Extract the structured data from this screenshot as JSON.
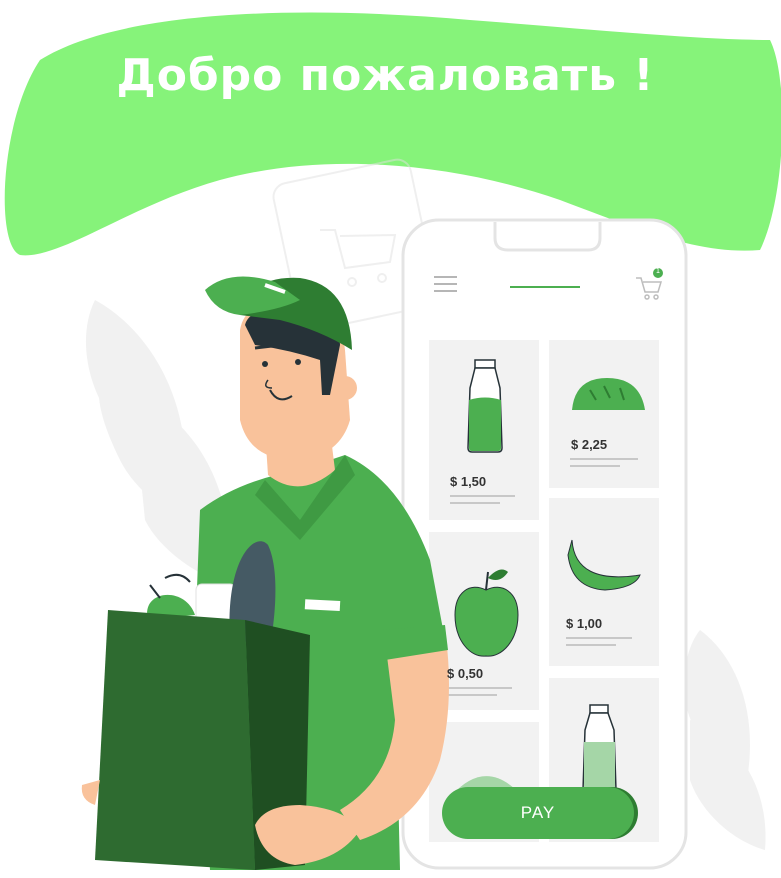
{
  "header": {
    "title": "Добро пожаловать !"
  },
  "cart": {
    "badge_count": "1"
  },
  "products": [
    {
      "name": "milk-bottle",
      "price": "$ 1,50"
    },
    {
      "name": "bread",
      "price": "$ 2,25"
    },
    {
      "name": "apple",
      "price": "$ 0,50"
    },
    {
      "name": "banana",
      "price": "$ 1,00"
    }
  ],
  "checkout": {
    "pay_label": "PAY"
  },
  "colors": {
    "banner": "#86f37a",
    "brand_green": "#4caf50",
    "dark_green": "#2e6b30",
    "skin": "#f9c29b",
    "card_bg": "#f2f2f2"
  }
}
